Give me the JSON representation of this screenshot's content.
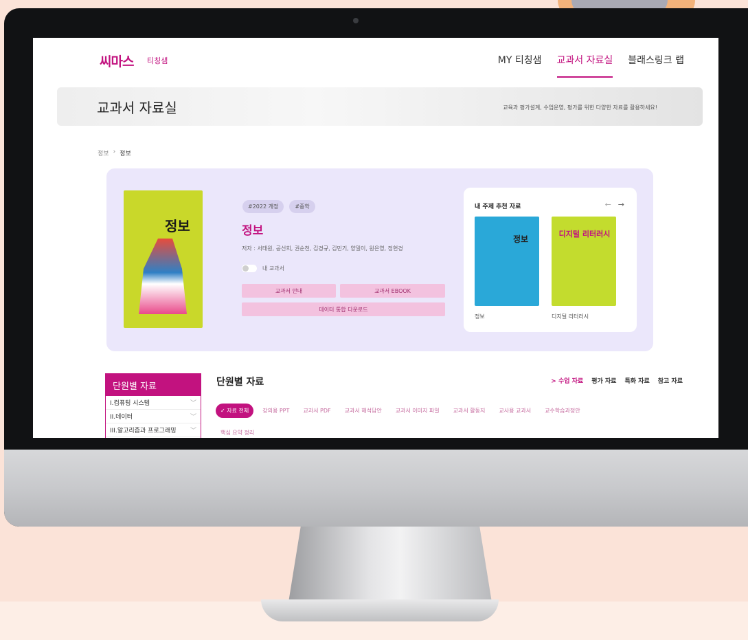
{
  "header": {
    "logo": "씨마스",
    "logo_sub": "티칭샘",
    "nav": [
      "MY 티칭샘",
      "교과서 자료실",
      "블래스링크 랩"
    ]
  },
  "banner": {
    "title": "교과서 자료실",
    "description": "교육과 평가설계, 수업운영, 평가를 위한 다양한 자료를 활용하세요!"
  },
  "breadcrumb": [
    "정보",
    "정보"
  ],
  "book": {
    "cover_title": "정보",
    "tags": [
      "#2022 개정",
      "#중학"
    ],
    "title": "정보",
    "authors": "저자 : 서태원, 공선희, 권순천, 김경규, 김민기, 양밀이, 원은영, 정현경",
    "toggle_label": "내 교과서",
    "buttons": {
      "guide": "교과서 안내",
      "ebook": "교과서 EBOOK",
      "download": "데이터 통합 다운로드"
    }
  },
  "recommend": {
    "title": "내 주제 추천 자료",
    "prev": "←",
    "next": "→",
    "books": [
      {
        "cover": "정보",
        "name": "정보"
      },
      {
        "cover": "디지털 리터러시",
        "name": "디지털 리터러시"
      }
    ]
  },
  "units": {
    "sidebar_title": "단원별 자료",
    "items": [
      "I.컴퓨팅 시스템",
      "II.데이터",
      "III.알고리즘과 프로그래밍"
    ],
    "title": "단원별 자료",
    "categories": [
      "> 수업 자료",
      "평가 자료",
      "특화 자료",
      "참고 자료"
    ],
    "chips": [
      "✓ 자료 전체",
      "강의용 PPT",
      "교과서 PDF",
      "교과서 해석답안",
      "교과서 이미지 파일",
      "교과서 활동지",
      "교사용 교과서",
      "교수학습과정안",
      "핵심 요약 정리"
    ]
  },
  "colors": {
    "brand": "#c2127f",
    "panel": "#ebe7fb"
  }
}
